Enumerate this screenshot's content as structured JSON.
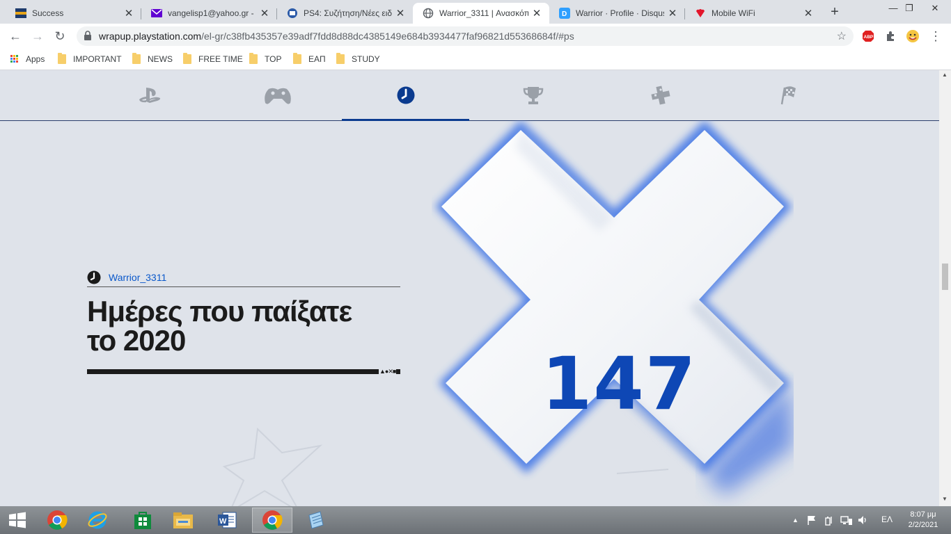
{
  "browser": {
    "tabs": [
      {
        "title": "Success",
        "icon": "success-favicon"
      },
      {
        "title": "vangelisp1@yahoo.gr - Y",
        "icon": "yahoo-mail-favicon"
      },
      {
        "title": "PS4: Συζήτηση/Νέες ειδή",
        "icon": "forum-favicon"
      },
      {
        "title": "Warrior_3311 | Ανασκόπ",
        "icon": "globe-favicon"
      },
      {
        "title": "Warrior · Profile · Disqus",
        "icon": "disqus-favicon"
      },
      {
        "title": "Mobile WiFi",
        "icon": "huawei-favicon"
      }
    ],
    "active_tab": 3,
    "new_tab": "+",
    "window": {
      "minimize": "—",
      "maximize": "❐",
      "close": "✕"
    },
    "url_host": "wrapup.playstation.com",
    "url_path": "/el-gr/c38fb435357e39adf7fdd8d88dc4385149e684b3934477faf96821d55368684f/#ps",
    "bookmarks": [
      "Apps",
      "IMPORTANT",
      "NEWS",
      "FREE TIME",
      "TOP",
      "ΕΑΠ",
      "STUDY"
    ]
  },
  "page": {
    "nav_icons": [
      "playstation-icon",
      "controller-icon",
      "clock-icon",
      "trophy-icon",
      "dpad-icon",
      "checkered-flag-icon"
    ],
    "active_nav": 2,
    "username": "Warrior_3311",
    "headline_line1": "Ημέρες που παίξατε",
    "headline_line2": "το 2020",
    "bar_symbols": "▲●✕■",
    "big_number": "147",
    "accent_color": "#0e47b5"
  },
  "taskbar": {
    "apps": [
      "chrome-icon",
      "internet-explorer-icon",
      "store-icon",
      "file-explorer-icon",
      "word-icon",
      "chrome-icon",
      "notepad-icon"
    ],
    "language": "ΕΛ",
    "time": "8:07 μμ",
    "date": "2/2/2021"
  }
}
